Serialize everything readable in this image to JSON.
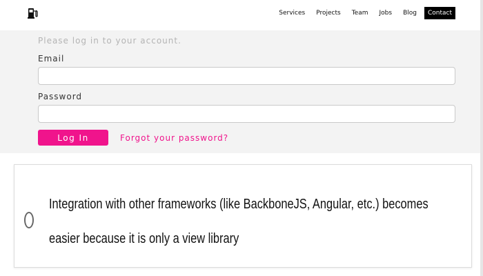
{
  "header": {
    "logo_icon": "fuel-pump-icon",
    "nav": [
      {
        "label": "Services"
      },
      {
        "label": "Projects"
      },
      {
        "label": "Team"
      },
      {
        "label": "Jobs"
      },
      {
        "label": "Blog"
      },
      {
        "label": "Contact"
      }
    ]
  },
  "login": {
    "intro": "Please log in to your account.",
    "email_label": "Email",
    "email_value": "",
    "password_label": "Password",
    "password_value": "",
    "login_button": "Log In",
    "forgot_link": "Forgot your password?"
  },
  "quiz": {
    "option_text": "Integration with other frameworks (like BackboneJS, Angular, etc.) becomes easier because it is only a view library",
    "selected": false
  },
  "colors": {
    "accent": "#f0148c",
    "panel_background": "#f3f3f3",
    "nav_active_background": "#000000"
  }
}
